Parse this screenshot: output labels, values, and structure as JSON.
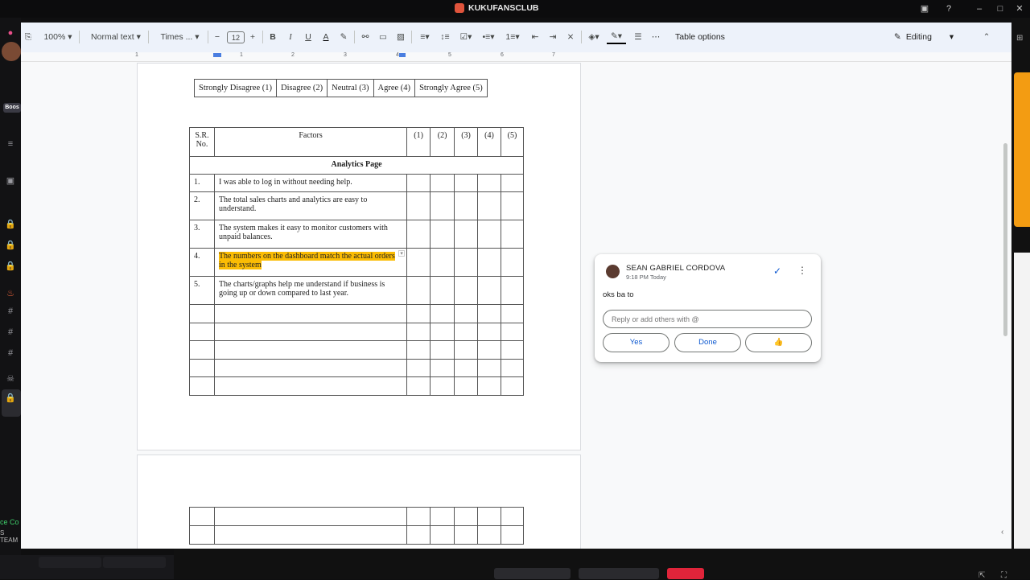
{
  "window": {
    "title": "KUKUFANSCLUB"
  },
  "left_strip": {
    "badge": "Boos",
    "bottom_text_1": "ce Co",
    "bottom_text_2": "S TEAM"
  },
  "toolbar": {
    "zoom": "100%",
    "style": "Normal text",
    "font": "Times ...",
    "font_size": "12",
    "table_options": "Table options",
    "mode": "Editing"
  },
  "ruler": {
    "numbers": [
      "1",
      "1",
      "2",
      "3",
      "4",
      "5",
      "6",
      "7"
    ]
  },
  "scale_table": {
    "cells": [
      "Strongly Disagree (1)",
      "Disagree (2)",
      "Neutral (3)",
      "Agree (4)",
      "Strongly Agree (5)"
    ]
  },
  "factors_table": {
    "headers": [
      "S.R. No.",
      "Factors",
      "(1)",
      "(2)",
      "(3)",
      "(4)",
      "(5)"
    ],
    "section": "Analytics Page",
    "rows": [
      {
        "no": "1.",
        "text": "I was able to log in without needing help."
      },
      {
        "no": "2.",
        "text": "The total sales charts and analytics are easy to understand."
      },
      {
        "no": "3.",
        "text": "The system makes it easy to monitor customers with unpaid balances."
      },
      {
        "no": "4.",
        "text": "The numbers on the dashboard match the actual orders in the system"
      },
      {
        "no": "5.",
        "text": "The charts/graphs help me understand if business is going up or down compared to last year."
      }
    ]
  },
  "comment": {
    "author": "SEAN GABRIEL CORDOVA",
    "time": "9:18 PM Today",
    "body": "oks ba to",
    "reply_placeholder": "Reply or add others with @",
    "chips": [
      "Yes",
      "Done",
      "👍"
    ]
  },
  "colors": {
    "highlight": "#fbbc04",
    "toolbar_bg": "#edf2fa",
    "accent": "#0b57d0"
  }
}
